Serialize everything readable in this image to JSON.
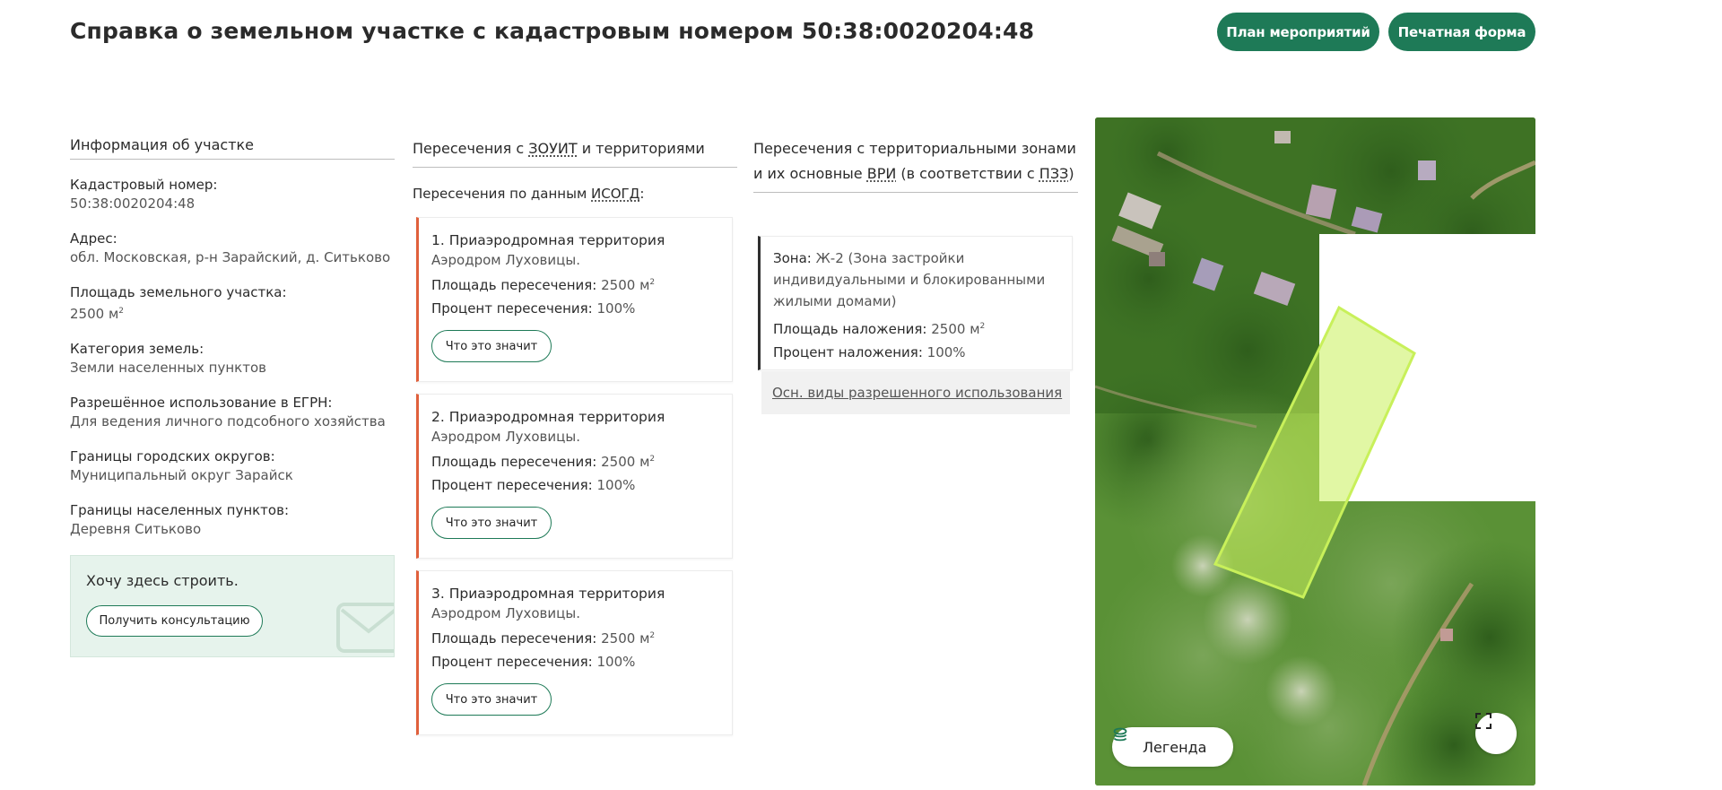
{
  "header": {
    "title": "Справка о земельном участке с кадастровым номером 50:38:0020204:48",
    "plan_button": "План мероприятий",
    "print_button": "Печатная форма"
  },
  "info": {
    "heading": "Информация об участке",
    "fields": [
      {
        "label": "Кадастровый номер:",
        "value": "50:38:0020204:48"
      },
      {
        "label": "Адрес:",
        "value": "обл. Московская, р-н Зарайский, д. Ситьково"
      },
      {
        "label": "Площадь земельного участка:",
        "value": "2500 м",
        "sup": "2"
      },
      {
        "label": "Категория земель:",
        "value": "Земли населенных пунктов"
      },
      {
        "label": "Разрешённое использование в ЕГРН:",
        "value": "Для ведения личного подсобного хозяйства"
      },
      {
        "label": "Границы городских округов:",
        "value": "Муниципальный округ Зарайск"
      },
      {
        "label": "Границы населенных пунктов:",
        "value": "Деревня Ситьково"
      }
    ],
    "build_box": {
      "text": "Хочу здесь строить.",
      "button": "Получить консультацию",
      "icon": "envelope-icon"
    }
  },
  "zouit": {
    "heading_pre": "Пересечения с ",
    "heading_abbr": "ЗОУИТ",
    "heading_post": " и территориями",
    "sub_pre": "Пересечения по данным ",
    "sub_abbr": "ИСОГД",
    "sub_post": ":",
    "area_label": "Площадь пересечения:",
    "percent_label": "Процент пересечения:",
    "button": "Что это значит",
    "cards": [
      {
        "title": "1. Приаэродромная территория",
        "subtitle": "Аэродром Луховицы.",
        "area": "2500 м",
        "sup": "2",
        "percent": "100%"
      },
      {
        "title": "2. Приаэродромная территория",
        "subtitle": "Аэродром Луховицы.",
        "area": "2500 м",
        "sup": "2",
        "percent": "100%"
      },
      {
        "title": "3. Приаэродромная территория",
        "subtitle": "Аэродром Луховицы.",
        "area": "2500 м",
        "sup": "2",
        "percent": "100%"
      }
    ]
  },
  "zones": {
    "heading_pre": "Пересечения с территориальными зонами и их основные ",
    "heading_abbr1": "ВРИ",
    "heading_mid": " (в соответствии с ",
    "heading_abbr2": "ПЗЗ",
    "heading_post": ")",
    "zone_label": "Зона:",
    "zone_value": "Ж-2 (Зона застройки индивидуальными и блокированными жилыми домами)",
    "area_label": "Площадь наложения:",
    "area_value": "2500 м",
    "area_sup": "2",
    "percent_label": "Процент наложения:",
    "percent_value": "100%",
    "link": "Осн. виды разрешенного использования"
  },
  "map": {
    "legend_label": "Легенда",
    "legend_icon": "layers-icon",
    "fullscreen_icon": "fullscreen-icon",
    "parcel_color": "#c8f05a"
  }
}
